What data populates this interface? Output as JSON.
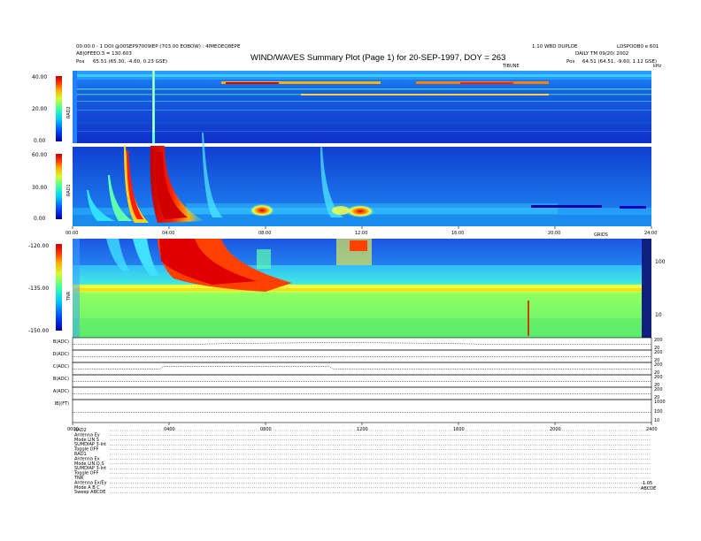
{
  "header": {
    "title": "WIND/WAVES Summary Plot (Page 1) for 20-SEP-1997, DOY = 263",
    "left_line1": "00:00:0 - 1 DOI @00SEP97009IEP (703.00 EOBOW) : 4IMEOEQ8EPE",
    "left_line2": "A8|0FEEO.3 = 130.603",
    "left_pos_label": "Pos",
    "left_pos_value": "65.51 (65.30, -4.60, 0.23 GSE)",
    "right_line1": "1.10 WBD DUPLOE",
    "right_line2": "LDSPOOB0 e 601",
    "right_line3": "DAILY TM 09/20/ 2002",
    "right_pos_label": "Pos",
    "right_pos_value": "64.51 (64.51, -9.60, 1.12 GSE)",
    "top_axis_label": "TIBUNE",
    "top_axis_right": "kHz"
  },
  "chart_data": [
    {
      "type": "heatmap",
      "name": "RAD2",
      "ylabel": "RAD2",
      "yticks": [
        "40.00",
        "20.00",
        "0.00"
      ],
      "ylim": [
        0,
        40
      ]
    },
    {
      "type": "heatmap",
      "name": "RAD1",
      "ylabel": "RAD1",
      "yticks": [
        "60.00",
        "30.00",
        "0.00"
      ],
      "ylim": [
        0,
        60
      ],
      "xticks": [
        "00:00",
        "04:00",
        "08:00",
        "12:00",
        "16:00",
        "20:00",
        "24:00"
      ]
    },
    {
      "type": "heatmap",
      "name": "TNR",
      "ylabel": "TNR",
      "yticks": [
        "-120.00",
        "-135.00",
        "-150.00"
      ],
      "ylim": [
        -150,
        -120
      ],
      "xlabel_right": "GRIDS",
      "right_axis_ticks": [
        "100",
        "10"
      ]
    },
    {
      "type": "line",
      "name": "housekeeping",
      "rows": [
        {
          "label": "B(ADC)",
          "right_ticks": [
            "200",
            "20"
          ]
        },
        {
          "label": "D(ADC)",
          "right_ticks": [
            "200",
            "20"
          ]
        },
        {
          "label": "C(ADC)",
          "right_ticks": [
            "200",
            "20"
          ]
        },
        {
          "label": "B(ADC)",
          "right_ticks": [
            "200",
            "20"
          ]
        },
        {
          "label": "A(ADC)",
          "right_ticks": [
            "200",
            "20"
          ]
        },
        {
          "label": "IB|(FT)",
          "right_ticks": [
            "1000",
            "100",
            "10"
          ]
        }
      ],
      "xticks": [
        "0000",
        "0400",
        "0800",
        "1200",
        "1600",
        "2000",
        "2400"
      ]
    }
  ],
  "footer": {
    "lines": [
      "RAD2",
      "Antenna    Ey",
      "Mode    LIN  S",
      "SUMDIAP 3-Int",
      "Toggle    OFF",
      "RAD1",
      "Antenna    Ex",
      "Mode    LIN,Q,S",
      "SUMDIAP 3-Int",
      "Toggle    OFF",
      "TNR",
      "Antenna    Ex/Ey",
      "Mode    A B C",
      "Sweep    ABCDE"
    ],
    "right_end_1": "1.05",
    "right_end_2": "ABCDE"
  },
  "colors": {
    "scale": [
      "#0000a0",
      "#0028ff",
      "#0090ff",
      "#00e0ff",
      "#40ffb0",
      "#b0ff40",
      "#ffff00",
      "#ff9000",
      "#ff2000",
      "#c00000"
    ]
  }
}
